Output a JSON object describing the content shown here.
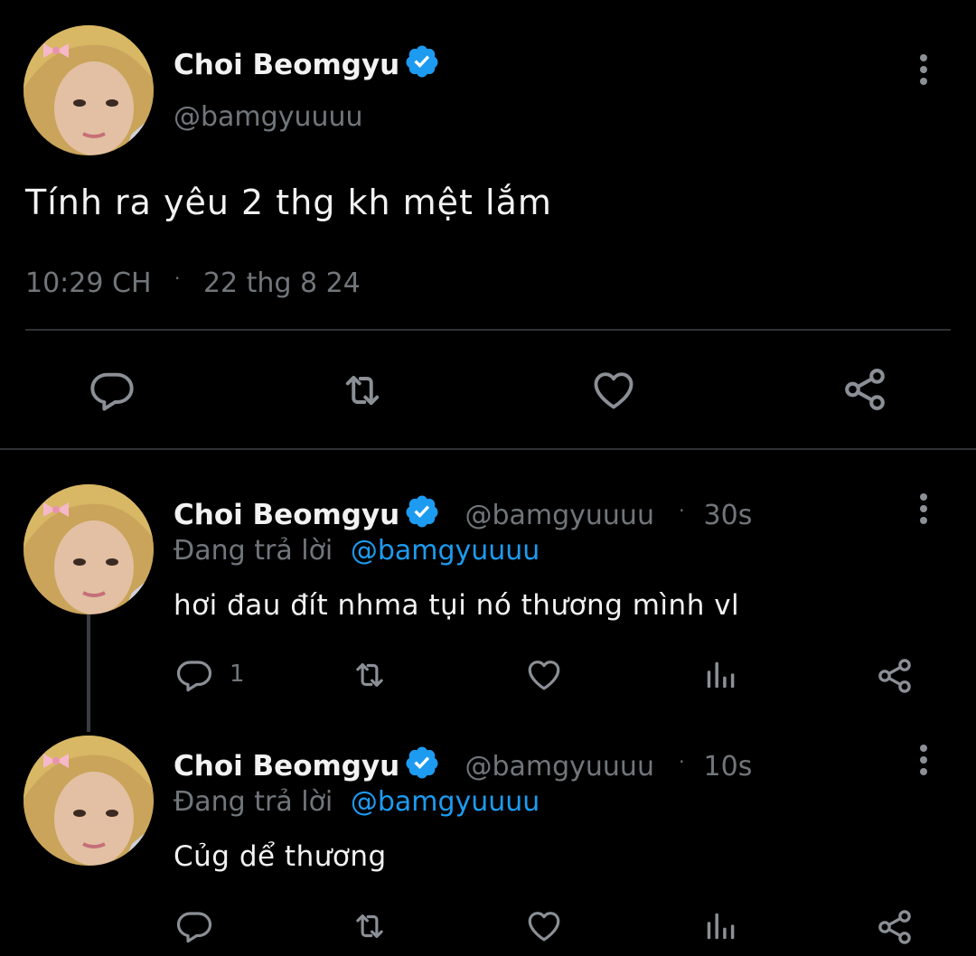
{
  "colors": {
    "accent": "#1d9bf0",
    "muted": "#71767b",
    "background": "#000000"
  },
  "main_tweet": {
    "author_name": "Choi Beomgyu",
    "author_handle": "@bamgyuuuu",
    "text": "Tính ra yêu 2 thg kh mệt lắm",
    "time": "10:29 CH",
    "separator": "·",
    "date": "22 thg 8 24",
    "actions": [
      "reply-icon",
      "retweet-icon",
      "like-icon",
      "share-icon"
    ]
  },
  "replies": [
    {
      "author_name": "Choi Beomgyu",
      "author_handle": "@bamgyuuuu",
      "separator": "·",
      "time_ago": "30s",
      "replying_prefix": "Đang trả lời",
      "replying_to": "@bamgyuuuu",
      "text": "hơi đau đít nhma tụi nó thương mình vl",
      "reply_count": "1",
      "actions": [
        "reply-icon",
        "retweet-icon",
        "like-icon",
        "views-icon",
        "share-icon"
      ]
    },
    {
      "author_name": "Choi Beomgyu",
      "author_handle": "@bamgyuuuu",
      "separator": "·",
      "time_ago": "10s",
      "replying_prefix": "Đang trả lời",
      "replying_to": "@bamgyuuuu",
      "text": "Củg dể thương",
      "reply_count": "",
      "actions": [
        "reply-icon",
        "retweet-icon",
        "like-icon",
        "views-icon",
        "share-icon"
      ]
    }
  ]
}
